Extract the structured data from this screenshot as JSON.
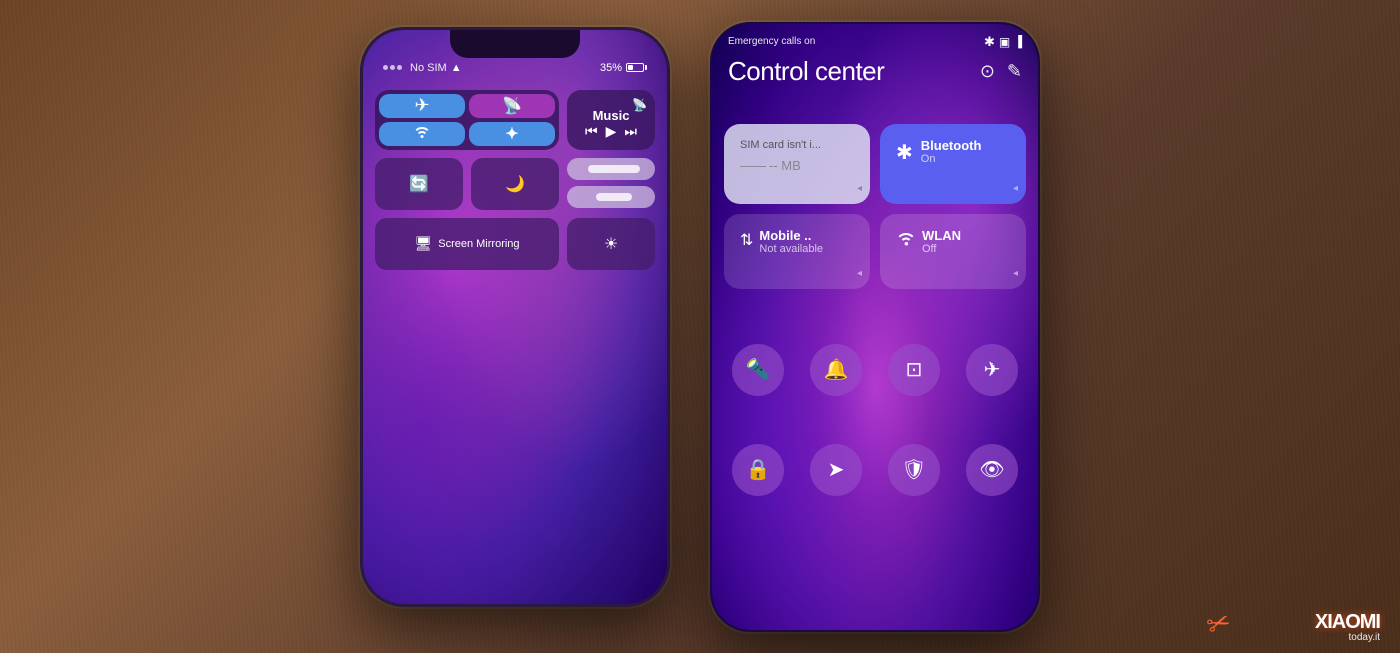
{
  "scene": {
    "background": "wooden table with two phones"
  },
  "iphone": {
    "status": {
      "carrier": "No SIM",
      "battery": "35%",
      "wifi_icon": "📶"
    },
    "controls": {
      "airplane_label": "✈",
      "cellular_label": "📡",
      "wifi_label": "📶",
      "bluetooth_label": "✦",
      "music_label": "Music",
      "screen_mirroring_label": "Screen Mirroring",
      "lock_rotation_icon": "🔄",
      "moon_icon": "🌙"
    }
  },
  "xiaomi": {
    "status": {
      "emergency_text": "Emergency calls on",
      "bluetooth_icon": "*",
      "battery_icon": "🔋"
    },
    "title": "Control center",
    "tiles": {
      "sim": {
        "label": "SIM card isn't i...",
        "sublabel": "-- MB",
        "state": "off"
      },
      "bluetooth": {
        "label": "Bluetooth",
        "sublabel": "On",
        "state": "on"
      },
      "mobile_data": {
        "label": "Mobile ..",
        "sublabel": "Not available",
        "state": "off"
      },
      "wlan": {
        "label": "WLAN",
        "sublabel": "Off",
        "state": "off"
      }
    },
    "circle_buttons_row1": [
      {
        "icon": "🔦",
        "label": "Flashlight"
      },
      {
        "icon": "🔔",
        "label": "Silent"
      },
      {
        "icon": "🖼",
        "label": "Screenshot"
      },
      {
        "icon": "✈",
        "label": "Airplane"
      }
    ],
    "circle_buttons_row2": [
      {
        "icon": "🔒",
        "label": "Lock"
      },
      {
        "icon": "➤",
        "label": "Location"
      },
      {
        "icon": "🔓",
        "label": "Privacy"
      },
      {
        "icon": "👁",
        "label": "Eye"
      }
    ],
    "watermark": {
      "brand": "XIAOMI",
      "site": "today.it"
    }
  }
}
